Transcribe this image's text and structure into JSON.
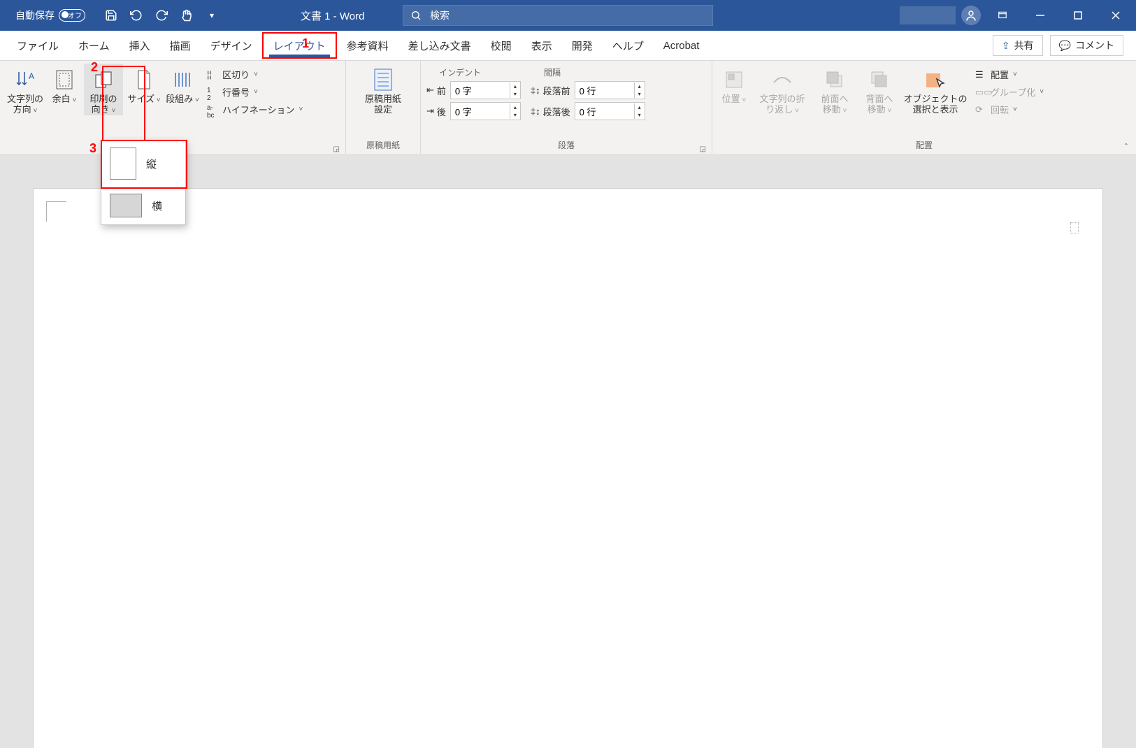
{
  "title": {
    "autosave_label": "自動保存",
    "autosave_state": "オフ",
    "doc": "文書 1  -  Word",
    "search_placeholder": "検索"
  },
  "tabs": {
    "file": "ファイル",
    "home": "ホーム",
    "insert": "挿入",
    "draw": "描画",
    "design": "デザイン",
    "layout": "レイアウト",
    "references": "参考資料",
    "mailings": "差し込み文書",
    "review": "校閲",
    "view": "表示",
    "developer": "開発",
    "help": "ヘルプ",
    "acrobat": "Acrobat",
    "share": "共有",
    "comments": "コメント"
  },
  "annotations": {
    "one": "1",
    "two": "2",
    "three": "3"
  },
  "page_setup": {
    "text_direction": "文字列の\n方向",
    "margins": "余白",
    "orientation": "印刷の\n向き",
    "size": "サイズ",
    "columns": "段組み",
    "breaks": "区切り",
    "line_numbers": "行番号",
    "hyphenation": "ハイフネーション",
    "group_label": ""
  },
  "manuscript": {
    "btn": "原稿用紙\n設定",
    "group_label": "原稿用紙"
  },
  "paragraph": {
    "indent_head": "インデント",
    "spacing_head": "間隔",
    "before_label": "前",
    "after_label": "後",
    "para_before_label": "段落前",
    "para_after_label": "段落後",
    "indent_before_value": "0 字",
    "indent_after_value": "0 字",
    "spacing_before_value": "0 行",
    "spacing_after_value": "0 行",
    "group_label": "段落"
  },
  "arrange": {
    "position": "位置",
    "wrap": "文字列の折\nり返し",
    "bring_forward": "前面へ\n移動",
    "send_backward": "背面へ\n移動",
    "selection_pane": "オブジェクトの\n選択と表示",
    "align": "配置",
    "group": "グループ化",
    "rotate": "回転",
    "group_label": "配置"
  },
  "orientation_menu": {
    "portrait": "縦",
    "landscape": "横"
  }
}
